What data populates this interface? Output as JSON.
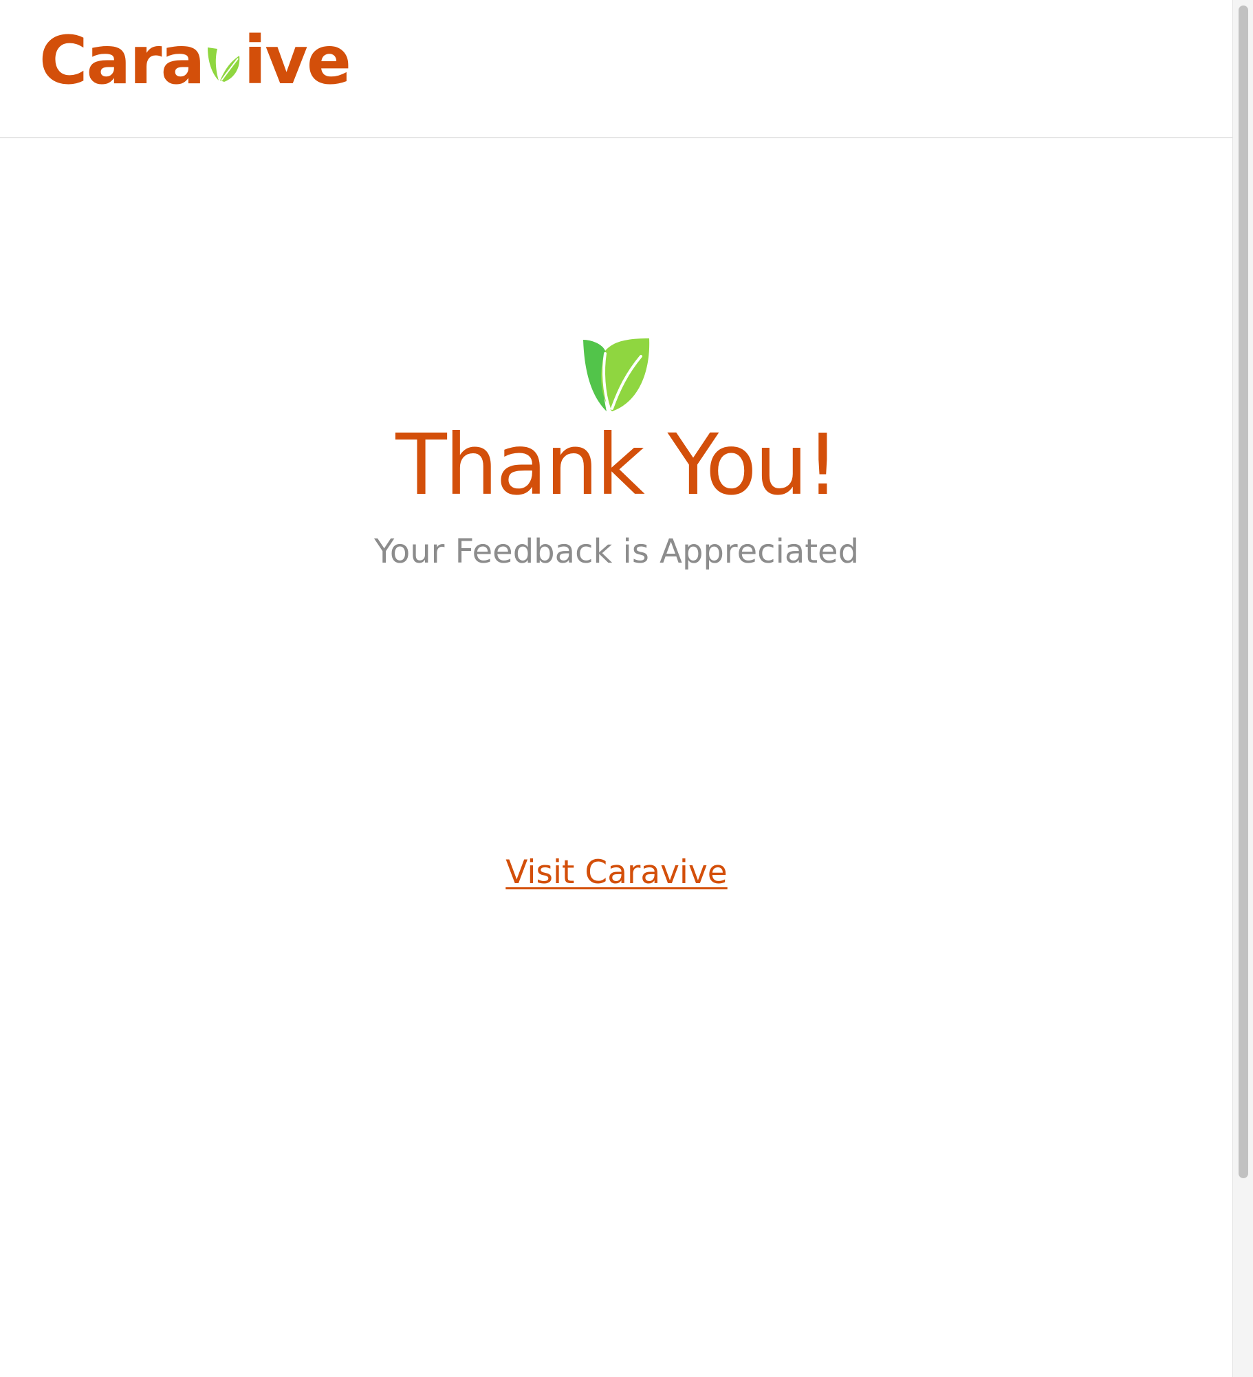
{
  "brand": {
    "name_part1": "Cara",
    "name_part2": "ive",
    "primary_color": "#d34f0a",
    "leaf_color_light": "#8fd640",
    "leaf_color_dark": "#52c44a"
  },
  "main": {
    "title": "Thank You!",
    "subtitle": "Your Feedback is Appreciated",
    "link_label": "Visit Caravive"
  },
  "icons": {
    "logo_leaf": "leaf-icon",
    "hero_leaf": "leaf-icon"
  }
}
